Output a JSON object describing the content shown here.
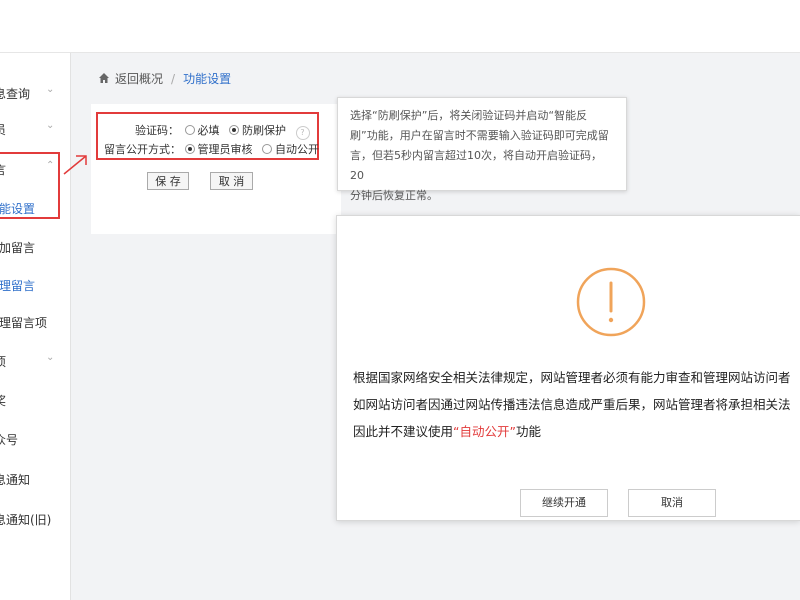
{
  "sidebar": {
    "items": [
      {
        "label": "息查询",
        "chevron": true
      },
      {
        "label": "员",
        "chevron": true
      },
      {
        "label": "言",
        "chevron": true
      },
      {
        "label": "能设置",
        "active": true
      },
      {
        "label": "加留言"
      },
      {
        "label": "理留言",
        "active": true
      },
      {
        "label": "理留言项"
      },
      {
        "label": "项",
        "chevron": true
      },
      {
        "label": "奖"
      },
      {
        "label": "众号"
      },
      {
        "label": "息通知"
      },
      {
        "label": "息通知(旧)"
      }
    ]
  },
  "breadcrumb": {
    "back": "返回概况",
    "separator": "/",
    "current": "功能设置"
  },
  "form": {
    "captcha_label": "验证码：",
    "captcha_options": [
      "必填",
      "防刷保护"
    ],
    "captcha_selected": "防刷保护",
    "help": "?",
    "publish_label": "留言公开方式：",
    "publish_options": [
      "管理员审核",
      "自动公开"
    ],
    "publish_selected": "管理员审核",
    "save": "保 存",
    "cancel": "取 消"
  },
  "tooltip": {
    "lines": [
      "选择“防刷保护”后，将关闭验证码并启动“智能反",
      "刷”功能，用户在留言时不需要输入验证码即可完成留",
      "言，但若5秒内留言超过10次，将自动开启验证码，20",
      "分钟后恢复正常。"
    ]
  },
  "dialog": {
    "icon": "warning-circle-icon",
    "line1": "根据国家网络安全相关法律规定，网站管理者必须有能力审查和管理网站访问者",
    "line2": "如网站访问者因通过网站传播违法信息造成严重后果，网站管理者将承担相关法",
    "line3_prefix": "因此并不建议使用",
    "line3_highlight": "“自动公开”",
    "line3_suffix": "功能",
    "confirm": "继续开通",
    "cancel": "取消"
  },
  "colors": {
    "accent": "#2f6fca",
    "warning": "#f0a45a",
    "annotation": "#e23b3b"
  }
}
